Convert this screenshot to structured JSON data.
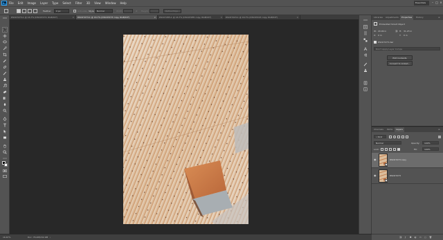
{
  "app": {
    "name": "Ps",
    "workspace": "Essentials"
  },
  "menu": [
    "File",
    "Edit",
    "Image",
    "Layer",
    "Type",
    "Select",
    "Filter",
    "3D",
    "View",
    "Window",
    "Help"
  ],
  "options": {
    "feather_label": "Feather:",
    "feather_value": "0 px",
    "anti_alias": "Anti-alias",
    "style_label": "Style:",
    "style_value": "Normal",
    "width_label": "Width:",
    "height_label": "Height:",
    "refine_edge": "Refine Edge..."
  },
  "tabs": [
    {
      "label": "DSC07273-1 @ 16.7% (DSC07273, RGB/16*)",
      "active": false
    },
    {
      "label": "DSC07273-1 @ 16.7% (DSC07273 copy, RGB/16*)",
      "active": true
    },
    {
      "label": "DSC07285-1 @ 16.7% (DSC07285 copy, RGB/16*)",
      "active": false
    },
    {
      "label": "DSC07223-1 @ 16.7% (DSC07223 copy, RGB/16*)",
      "active": false
    }
  ],
  "status": {
    "zoom": "16.67%",
    "doc": "Doc: 76.4M/152.9M"
  },
  "properties": {
    "tabs": [
      "Libraries",
      "Adjustments",
      "Properties",
      "History"
    ],
    "active_tab": "Properties",
    "object_type": "Embedded Smart Object",
    "w_label": "W:",
    "w_value": "20.99 in",
    "h_label": "H:",
    "h_value": "31.23 in",
    "x_label": "X:",
    "x_value": "0 in",
    "y_label": "Y:",
    "y_value": "0 in",
    "filename": "DSC07273.dwr",
    "comps_placeholder": "Don't Apply Layer Comps",
    "edit_contents": "Edit Contents",
    "convert_linked": "Convert to Linked..."
  },
  "layers_panel": {
    "tabs": [
      "Channels",
      "Paths",
      "Layers"
    ],
    "active_tab": "Layers",
    "kind": "Kind",
    "blend_mode": "Normal",
    "opacity_label": "Opacity:",
    "opacity_value": "100%",
    "lock_label": "Lock:",
    "fill_label": "Fill:",
    "fill_value": "100%",
    "layers": [
      {
        "name": "DSC07273 copy",
        "selected": true
      },
      {
        "name": "DSC07273",
        "selected": false
      }
    ]
  },
  "icons": {
    "eye": "eye-icon",
    "smart_object": "smart-object-badge-icon"
  },
  "colors": {
    "ui_dark": "#282828",
    "ui_panel": "#535353",
    "selection": "#6c6c6c",
    "rust": "#c58a5c",
    "metal": "#d9cbb8"
  }
}
